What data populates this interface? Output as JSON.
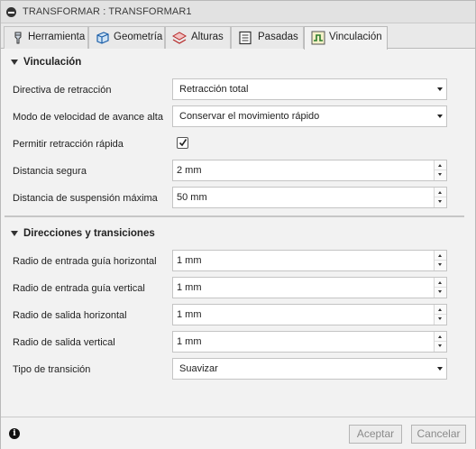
{
  "window": {
    "title": "TRANSFORMAR : TRANSFORMAR1",
    "title_icon": "minus-circle-icon"
  },
  "tabs": [
    {
      "label": "Herramienta",
      "icon": "tool-icon",
      "active": false
    },
    {
      "label": "Geometría",
      "icon": "geometry-icon",
      "active": false
    },
    {
      "label": "Alturas",
      "icon": "heights-icon",
      "active": false
    },
    {
      "label": "Pasadas",
      "icon": "passes-icon",
      "active": false
    },
    {
      "label": "Vinculación",
      "icon": "linking-icon",
      "active": true
    }
  ],
  "vinculacion": {
    "title": "Vinculación",
    "retract_policy": {
      "label": "Directiva de retracción",
      "value": "Retracción total"
    },
    "feed_mode": {
      "label": "Modo de velocidad de avance alta",
      "value": "Conservar el movimiento rápido"
    },
    "rapid_retract": {
      "label": "Permitir retracción rápida",
      "checked": true
    },
    "safe_distance": {
      "label": "Distancia segura",
      "value": "2 mm"
    },
    "max_stay_down": {
      "label": "Distancia de suspensión máxima",
      "value": "50 mm"
    }
  },
  "transiciones": {
    "title": "Direcciones y transiciones",
    "lead_in_h": {
      "label": "Radio de entrada guía horizontal",
      "value": "1 mm"
    },
    "lead_in_v": {
      "label": "Radio de entrada guía vertical",
      "value": "1 mm"
    },
    "lead_out_h": {
      "label": "Radio de salida horizontal",
      "value": "1 mm"
    },
    "lead_out_v": {
      "label": "Radio de salida vertical",
      "value": "1 mm"
    },
    "transition_type": {
      "label": "Tipo de transición",
      "value": "Suavizar"
    }
  },
  "footer": {
    "info_icon": "info-icon",
    "ok_label": "Aceptar",
    "cancel_label": "Cancelar"
  }
}
